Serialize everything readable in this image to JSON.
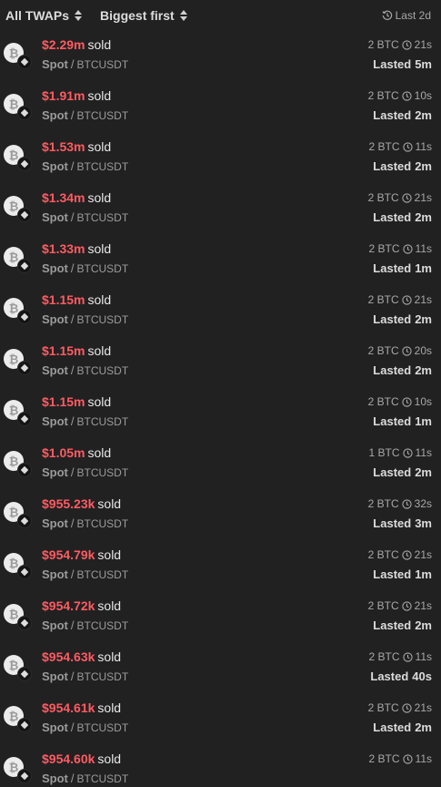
{
  "header": {
    "filter_label": "All TWAPs",
    "sort_label": "Biggest first",
    "range_label": "Last 2d"
  },
  "lasted_label": "Lasted",
  "separator": "/",
  "rows": [
    {
      "amount": "$2.29m",
      "side": "sold",
      "market": "Spot",
      "pair": "BTCUSDT",
      "size": "2 BTC",
      "interval": "21s",
      "duration": "5m"
    },
    {
      "amount": "$1.91m",
      "side": "sold",
      "market": "Spot",
      "pair": "BTCUSDT",
      "size": "2 BTC",
      "interval": "10s",
      "duration": "2m"
    },
    {
      "amount": "$1.53m",
      "side": "sold",
      "market": "Spot",
      "pair": "BTCUSDT",
      "size": "2 BTC",
      "interval": "11s",
      "duration": "2m"
    },
    {
      "amount": "$1.34m",
      "side": "sold",
      "market": "Spot",
      "pair": "BTCUSDT",
      "size": "2 BTC",
      "interval": "21s",
      "duration": "2m"
    },
    {
      "amount": "$1.33m",
      "side": "sold",
      "market": "Spot",
      "pair": "BTCUSDT",
      "size": "2 BTC",
      "interval": "11s",
      "duration": "1m"
    },
    {
      "amount": "$1.15m",
      "side": "sold",
      "market": "Spot",
      "pair": "BTCUSDT",
      "size": "2 BTC",
      "interval": "21s",
      "duration": "2m"
    },
    {
      "amount": "$1.15m",
      "side": "sold",
      "market": "Spot",
      "pair": "BTCUSDT",
      "size": "2 BTC",
      "interval": "20s",
      "duration": "2m"
    },
    {
      "amount": "$1.15m",
      "side": "sold",
      "market": "Spot",
      "pair": "BTCUSDT",
      "size": "2 BTC",
      "interval": "10s",
      "duration": "1m"
    },
    {
      "amount": "$1.05m",
      "side": "sold",
      "market": "Spot",
      "pair": "BTCUSDT",
      "size": "1 BTC",
      "interval": "11s",
      "duration": "2m"
    },
    {
      "amount": "$955.23k",
      "side": "sold",
      "market": "Spot",
      "pair": "BTCUSDT",
      "size": "2 BTC",
      "interval": "32s",
      "duration": "3m"
    },
    {
      "amount": "$954.79k",
      "side": "sold",
      "market": "Spot",
      "pair": "BTCUSDT",
      "size": "2 BTC",
      "interval": "21s",
      "duration": "1m"
    },
    {
      "amount": "$954.72k",
      "side": "sold",
      "market": "Spot",
      "pair": "BTCUSDT",
      "size": "2 BTC",
      "interval": "21s",
      "duration": "2m"
    },
    {
      "amount": "$954.63k",
      "side": "sold",
      "market": "Spot",
      "pair": "BTCUSDT",
      "size": "2 BTC",
      "interval": "11s",
      "duration": "40s"
    },
    {
      "amount": "$954.61k",
      "side": "sold",
      "market": "Spot",
      "pair": "BTCUSDT",
      "size": "2 BTC",
      "interval": "21s",
      "duration": "2m"
    },
    {
      "amount": "$954.60k",
      "side": "sold",
      "market": "Spot",
      "pair": "BTCUSDT",
      "size": "2 BTC",
      "interval": "11s",
      "duration": ""
    }
  ],
  "colors": {
    "background": "#212121",
    "sell": "#ff5b63",
    "muted": "#9b9b9b"
  },
  "icons": {
    "coin": "bitcoin-icon",
    "exchange": "binance-icon",
    "interval": "clock-icon",
    "range": "history-icon",
    "sort": "sort-updown-icon"
  }
}
